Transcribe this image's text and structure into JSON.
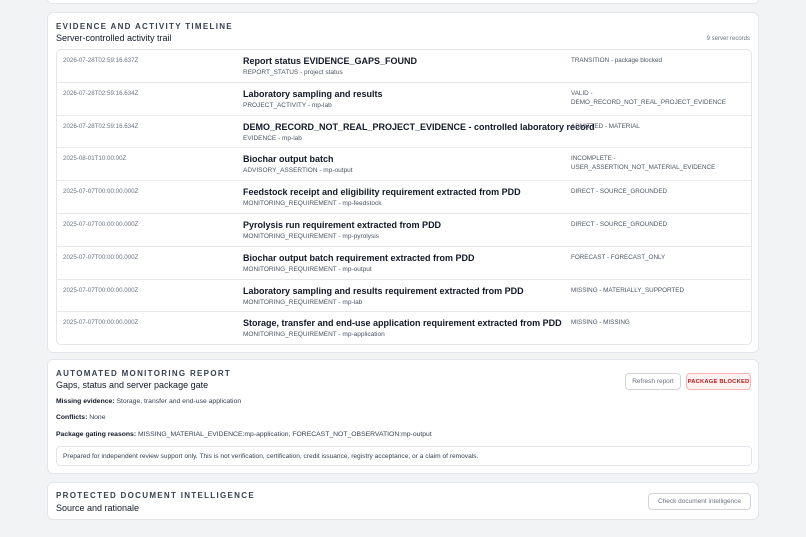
{
  "timeline": {
    "eyebrow": "EVIDENCE AND ACTIVITY TIMELINE",
    "subtitle": "Server-controlled activity trail",
    "record_count": "9 server records",
    "rows": [
      {
        "time": "2026-07-28T02:59:16.637Z",
        "title": "Report status EVIDENCE_GAPS_FOUND",
        "sub": "REPORT_STATUS - project status",
        "status": "TRANSITION - package blocked"
      },
      {
        "time": "2026-07-28T02:59:16.634Z",
        "title": "Laboratory sampling and results",
        "sub": "PROJECT_ACTIVITY - mp-lab",
        "status": "VALID - DEMO_RECORD_NOT_REAL_PROJECT_EVIDENCE"
      },
      {
        "time": "2026-07-28T02:59:16.634Z",
        "title": "DEMO_RECORD_NOT_REAL_PROJECT_EVIDENCE - controlled laboratory record",
        "sub": "EVIDENCE - mp-lab",
        "status": "ADMITTED - MATERIAL"
      },
      {
        "time": "2025-08-01T10:00:00Z",
        "title": "Biochar output batch",
        "sub": "ADVISORY_ASSERTION - mp-output",
        "status": "INCOMPLETE - USER_ASSERTION_NOT_MATERIAL_EVIDENCE"
      },
      {
        "time": "2025-07-07T00:00:00.000Z",
        "title": "Feedstock receipt and eligibility requirement extracted from PDD",
        "sub": "MONITORING_REQUIREMENT - mp-feedstock",
        "status": "DIRECT - SOURCE_GROUNDED"
      },
      {
        "time": "2025-07-07T00:00:00.000Z",
        "title": "Pyrolysis run requirement extracted from PDD",
        "sub": "MONITORING_REQUIREMENT - mp-pyrolysis",
        "status": "DIRECT - SOURCE_GROUNDED"
      },
      {
        "time": "2025-07-07T00:00:00.000Z",
        "title": "Biochar output batch requirement extracted from PDD",
        "sub": "MONITORING_REQUIREMENT - mp-output",
        "status": "FORECAST - FORECAST_ONLY"
      },
      {
        "time": "2025-07-07T00:00:00.000Z",
        "title": "Laboratory sampling and results requirement extracted from PDD",
        "sub": "MONITORING_REQUIREMENT - mp-lab",
        "status": "MISSING - MATERIALLY_SUPPORTED"
      },
      {
        "time": "2025-07-07T00:00:00.000Z",
        "title": "Storage, transfer and end-use application requirement extracted from PDD",
        "sub": "MONITORING_REQUIREMENT - mp-application",
        "status": "MISSING - MISSING"
      }
    ]
  },
  "report": {
    "eyebrow": "AUTOMATED MONITORING REPORT",
    "subtitle": "Gaps, status and server package gate",
    "refresh_label": "Refresh report",
    "badge_label": "PACKAGE BLOCKED",
    "missing_label": "Missing evidence:",
    "missing_value": "Storage, transfer and end-use application",
    "conflicts_label": "Conflicts:",
    "conflicts_value": "None",
    "gating_label": "Package gating reasons:",
    "gating_value": "MISSING_MATERIAL_EVIDENCE:mp-application, FORECAST_NOT_OBSERVATION:mp-output",
    "disclaimer": "Prepared for independent review support only. This is not verification, certification, credit issuance, registry acceptance, or a claim of removals."
  },
  "intel": {
    "eyebrow": "PROTECTED DOCUMENT INTELLIGENCE",
    "subtitle": "Source and rationale",
    "check_label": "Check document intelligence"
  },
  "colors": {
    "blocked_text": "#b91c1c",
    "blocked_bg": "#fdf2f2",
    "page_bg": "#f2f3f5"
  }
}
